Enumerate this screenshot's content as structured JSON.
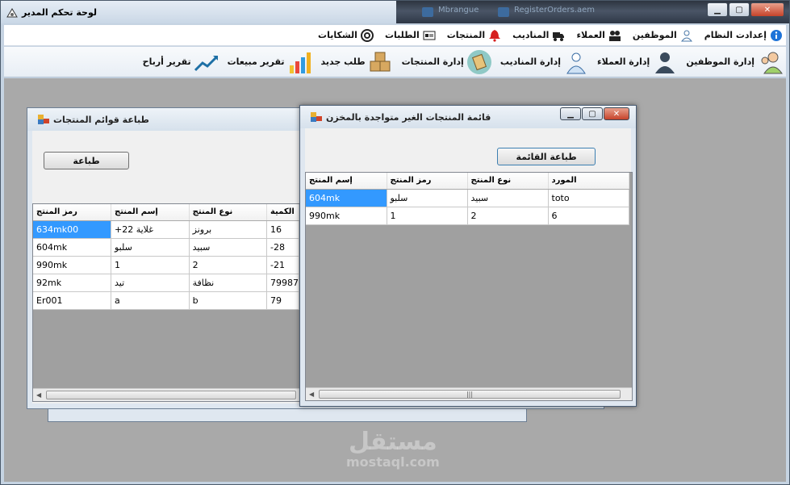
{
  "window": {
    "title": "لوحة تحكم المدير",
    "ghost_tabs": [
      "Mbrangue",
      "RegisterOrders.aem"
    ]
  },
  "menu": [
    {
      "label": "إعدادت النظام",
      "icon": "info-icon"
    },
    {
      "label": "الموظفين",
      "icon": "user-icon"
    },
    {
      "label": "العملاء",
      "icon": "customers-icon"
    },
    {
      "label": "المناديب",
      "icon": "truck-icon"
    },
    {
      "label": "المنتجات",
      "icon": "bell-icon"
    },
    {
      "label": "الطلبات",
      "icon": "list-icon"
    },
    {
      "label": "الشكايات",
      "icon": "lifebuoy-icon"
    }
  ],
  "toolbar": [
    {
      "label": "إدارة الموظفين",
      "icon": "employees-icon"
    },
    {
      "label": "إدارة العملاء",
      "icon": "customer-icon"
    },
    {
      "label": "إدارة المناديب",
      "icon": "delegate-icon"
    },
    {
      "label": "إدارة المنتجات",
      "icon": "boxes-icon"
    },
    {
      "label": "طلب جديد",
      "icon": "new-order-icon"
    },
    {
      "label": "تقرير مبيعات",
      "icon": "bar-chart-icon"
    },
    {
      "label": "تقرير أرباح",
      "icon": "trend-icon"
    }
  ],
  "print_window": {
    "title": "طباعة قوائم المنتجات",
    "print_button": "طباعة",
    "columns": [
      "رمز المنتج",
      "إسم المنتج",
      "نوع المنتج",
      "الكمية"
    ],
    "rows": [
      [
        "634mk00",
        "+غلاية 22",
        "برونز",
        "16"
      ],
      [
        "604mk",
        "سلبو",
        "سبيد",
        "-28"
      ],
      [
        "990mk",
        "1",
        "2",
        "-21"
      ],
      [
        "92mk",
        "تيد",
        "نظافة",
        "79987"
      ],
      [
        "Er001",
        "a",
        "b",
        "79"
      ]
    ]
  },
  "missing_window": {
    "title": "قائمة المنتجات الغير متواجدة بالمخزن",
    "print_button": "طباعة القائمة",
    "columns": [
      "إسم المنتج",
      "رمز المنتج",
      "نوع المنتج",
      "المورد"
    ],
    "rows": [
      [
        "604mk",
        "سلبو",
        "سبيد",
        "toto"
      ],
      [
        "990mk",
        "1",
        "2",
        "6"
      ]
    ]
  },
  "watermark": {
    "ar": "مستقل",
    "en": "mostaql.com"
  },
  "colors": {
    "selection": "#3399ff",
    "mdi_background": "#a9a9a9"
  }
}
